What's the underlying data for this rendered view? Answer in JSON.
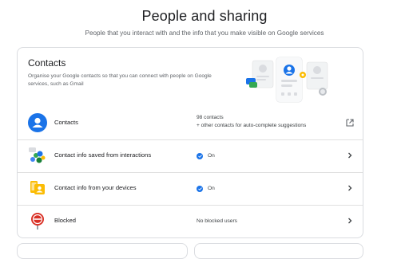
{
  "header": {
    "title": "People and sharing",
    "subtitle": "People that you interact with and the info that you make visible on Google services"
  },
  "contacts_card": {
    "title": "Contacts",
    "description": "Organise your Google contacts so that you can connect with people on Google services, such as Gmail",
    "illustration": "contacts-illustration",
    "rows": [
      {
        "label": "Contacts",
        "status_line1": "98 contacts",
        "status_line2": "+ other contacts for auto-complete suggestions",
        "icon": "person-icon",
        "action_icon": "open-in-new-icon"
      },
      {
        "label": "Contact info saved from interactions",
        "status": "On",
        "icon": "contacts-interactions-icon",
        "action_icon": "chevron-right-icon"
      },
      {
        "label": "Contact info from your devices",
        "status": "On",
        "icon": "device-contacts-icon",
        "action_icon": "chevron-right-icon"
      },
      {
        "label": "Blocked",
        "status": "No blocked users",
        "icon": "blocked-icon",
        "action_icon": "chevron-right-icon"
      }
    ]
  },
  "colors": {
    "accent": "#1a73e8",
    "text_primary": "#202124",
    "text_secondary": "#5f6368",
    "border": "#dadce0"
  }
}
